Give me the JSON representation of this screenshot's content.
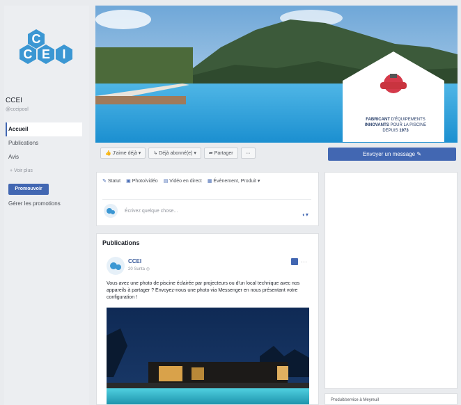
{
  "page": {
    "name": "CCEI",
    "handle": "@cceipool"
  },
  "logo": {
    "letters": [
      "C",
      "C",
      "E",
      "I"
    ],
    "color": "#3b97d3"
  },
  "nav": {
    "items": [
      {
        "label": "Accueil",
        "active": true
      },
      {
        "label": "Publications",
        "active": false
      },
      {
        "label": "Avis",
        "active": false
      }
    ],
    "more_label": "+ Voir plus",
    "promote_label": "Promouvoir",
    "manage_promotions_label": "Gérer les promotions"
  },
  "cover": {
    "badge_line1_bold": "FABRICANT",
    "badge_line1_rest": "D'ÉQUIPEMENTS",
    "badge_line2_bold": "INNOVANTS",
    "badge_line2_rest": "POUR LA PISCINE",
    "badge_line3": "DEPUIS",
    "badge_year": "1973"
  },
  "actions": {
    "like_label": "J'aime déjà ▾",
    "follow_label": "Déjà abonné(e) ▾",
    "share_label": "Partager",
    "more_label": "···",
    "message_label": "Envoyer un message ✎"
  },
  "composer": {
    "tabs": [
      "Statut",
      "Photo/vidéo",
      "Vidéo en direct",
      "Évènement, Produit ▾"
    ],
    "placeholder": "Écrivez quelque chose..."
  },
  "publications": {
    "title": "Publications",
    "post": {
      "author": "CCEI",
      "date": "20 Sunta",
      "text": "Vous avez une photo de piscine éclairée par projecteurs ou d'un local technique avec nos appareils à partager ? Envoyez-nous une photo via Messenger en nous présentant votre configuration !"
    }
  },
  "right_column": {
    "footer_text": "Produit/service à Meyreuil"
  },
  "colors": {
    "accent": "#4267b2",
    "brand_blue": "#3b97d3",
    "background": "#e9ebee"
  }
}
